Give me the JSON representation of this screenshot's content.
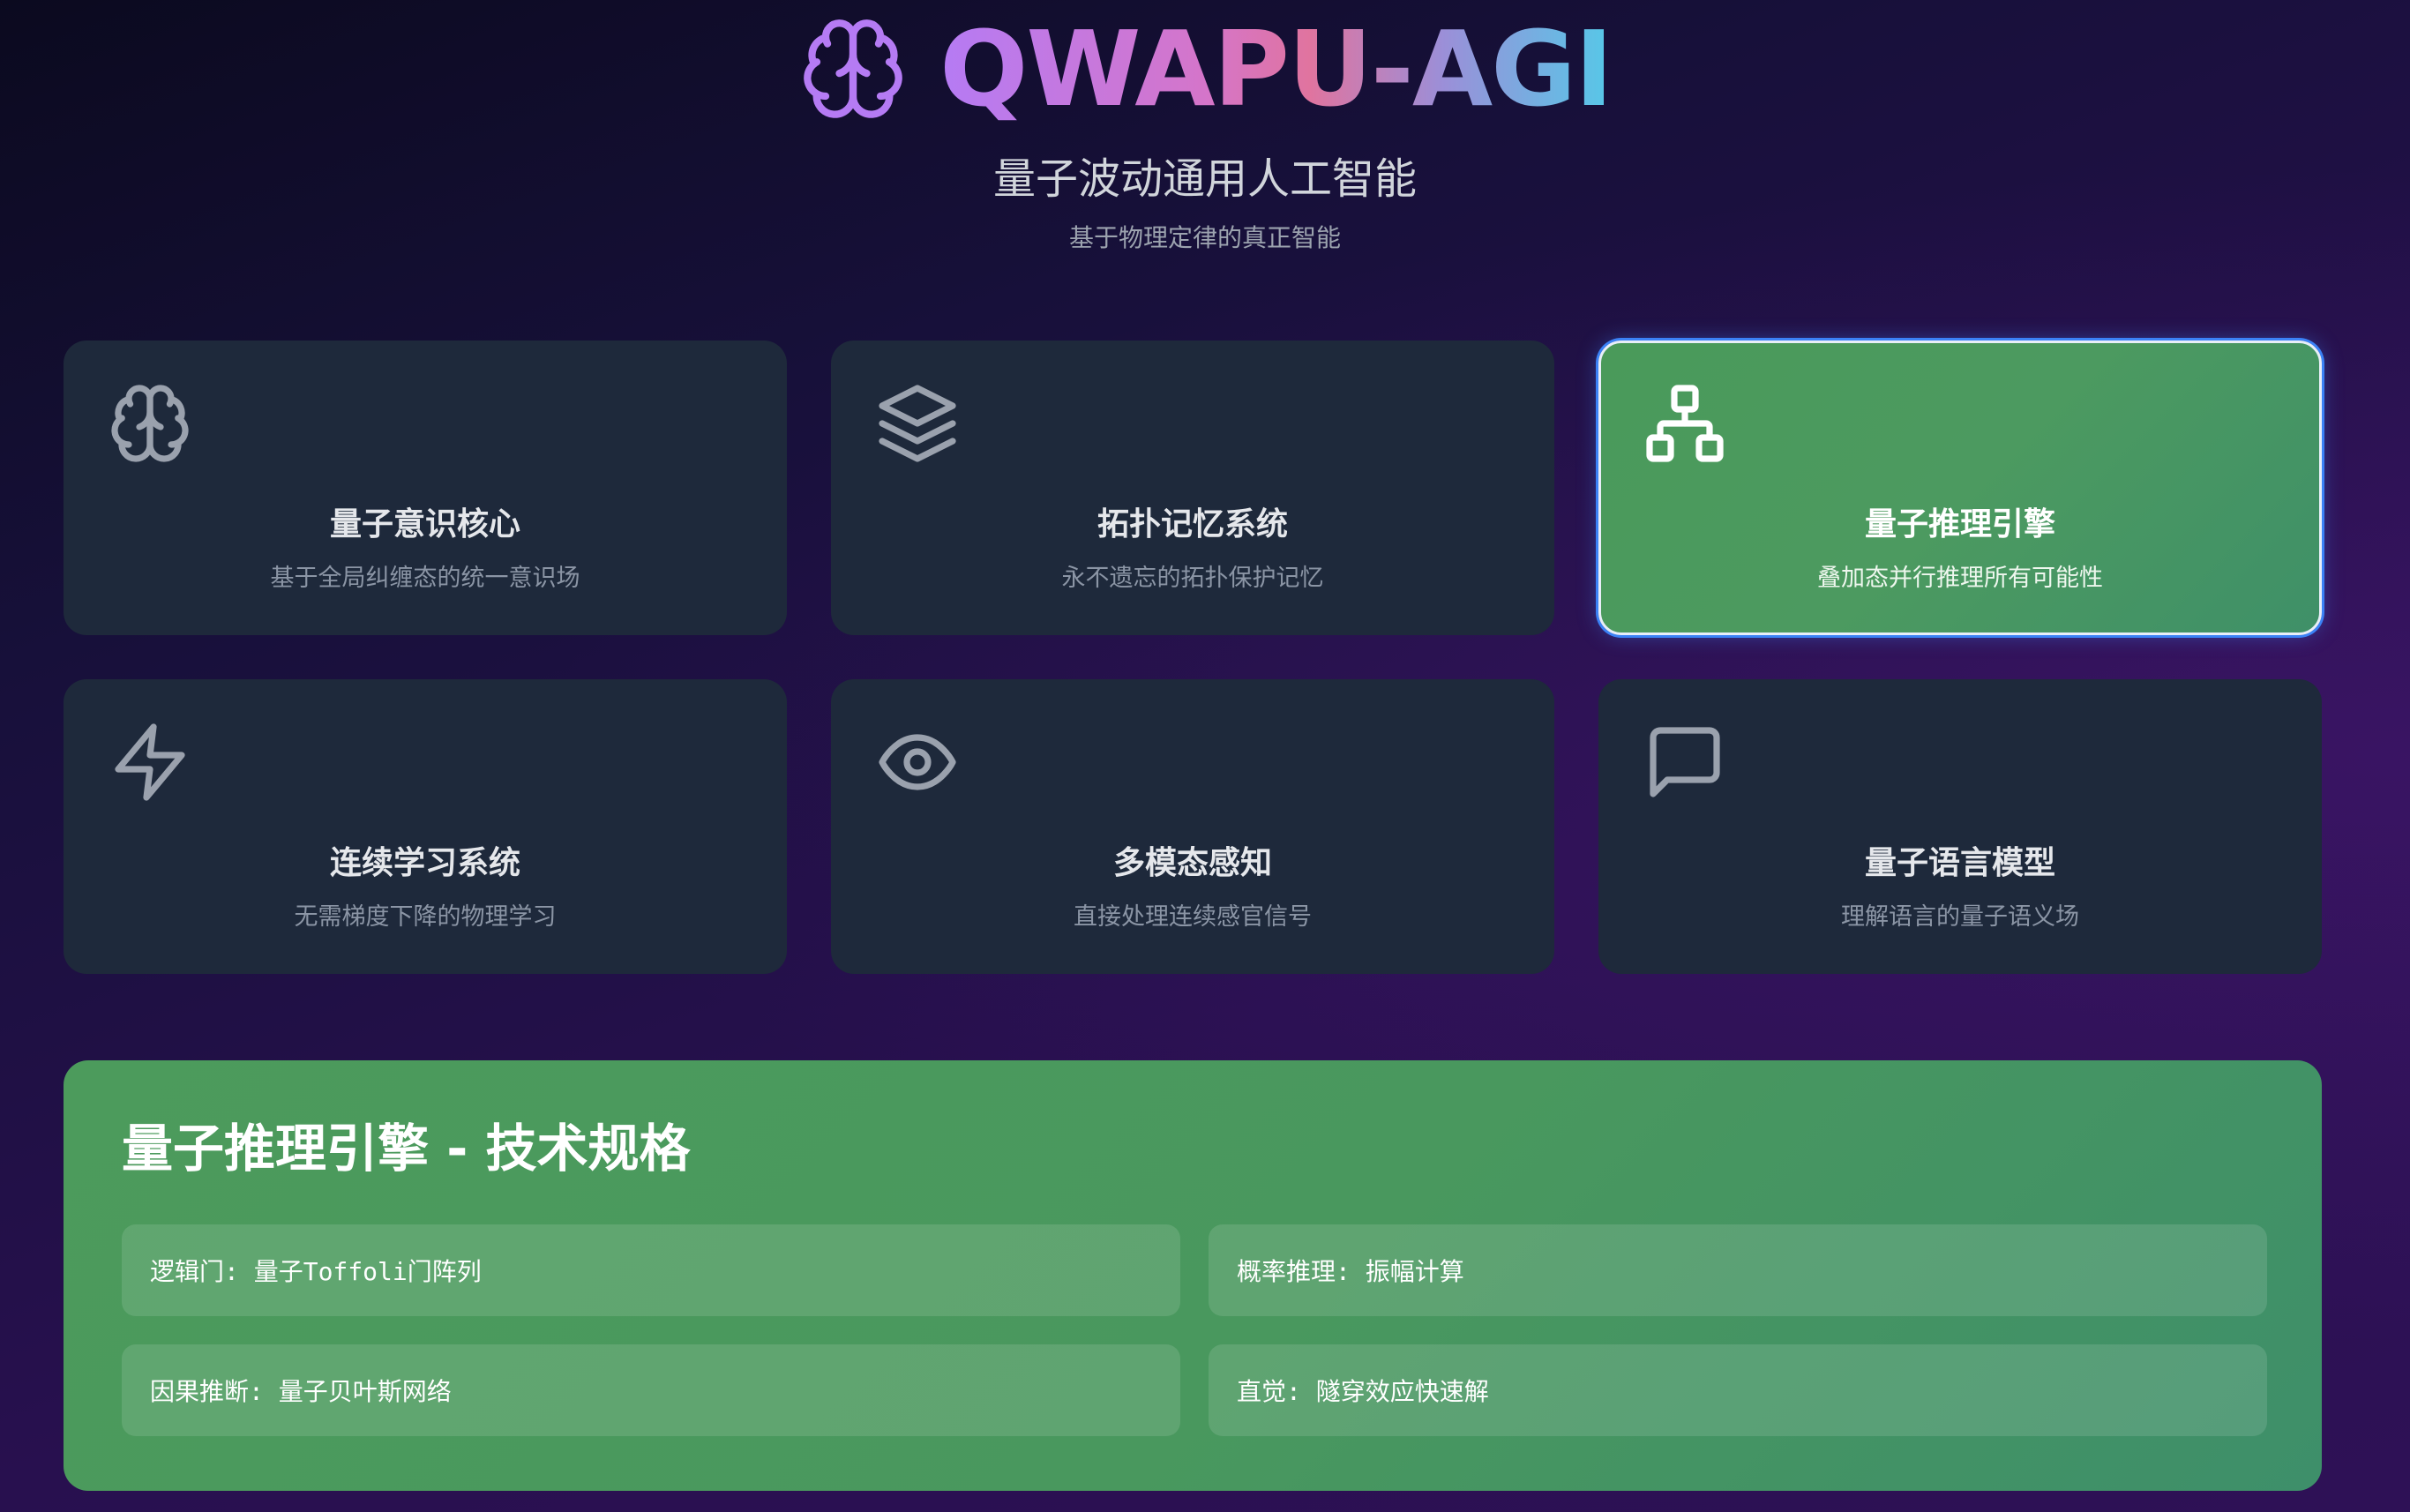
{
  "header": {
    "title": "QWAPU-AGI",
    "subtitle": "量子波动通用人工智能",
    "tagline": "基于物理定律的真正智能",
    "logo_icon": "brain-icon"
  },
  "features": [
    {
      "icon": "brain-icon",
      "title": "量子意识核心",
      "description": "基于全局纠缠态的统一意识场",
      "selected": false
    },
    {
      "icon": "layers-icon",
      "title": "拓扑记忆系统",
      "description": "永不遗忘的拓扑保护记忆",
      "selected": false
    },
    {
      "icon": "network-icon",
      "title": "量子推理引擎",
      "description": "叠加态并行推理所有可能性",
      "selected": true
    },
    {
      "icon": "lightning-icon",
      "title": "连续学习系统",
      "description": "无需梯度下降的物理学习",
      "selected": false
    },
    {
      "icon": "eye-icon",
      "title": "多模态感知",
      "description": "直接处理连续感官信号",
      "selected": false
    },
    {
      "icon": "message-square-icon",
      "title": "量子语言模型",
      "description": "理解语言的量子语义场",
      "selected": false
    }
  ],
  "spec_panel": {
    "title": "量子推理引擎 - 技术规格",
    "items": [
      "逻辑门: 量子Toffoli门阵列",
      "概率推理: 振幅计算",
      "因果推断: 量子贝叶斯网络",
      "直觉: 隧穿效应快速解"
    ]
  },
  "colors": {
    "background_top": "#0b0a1f",
    "background_bottom": "#2e1156",
    "card_bg": "#1e293b",
    "active_green": "#4a9a5a",
    "active_border": "#3b82f6",
    "title_gradient_start": "#b57bf4",
    "title_gradient_end": "#56c8e8"
  }
}
